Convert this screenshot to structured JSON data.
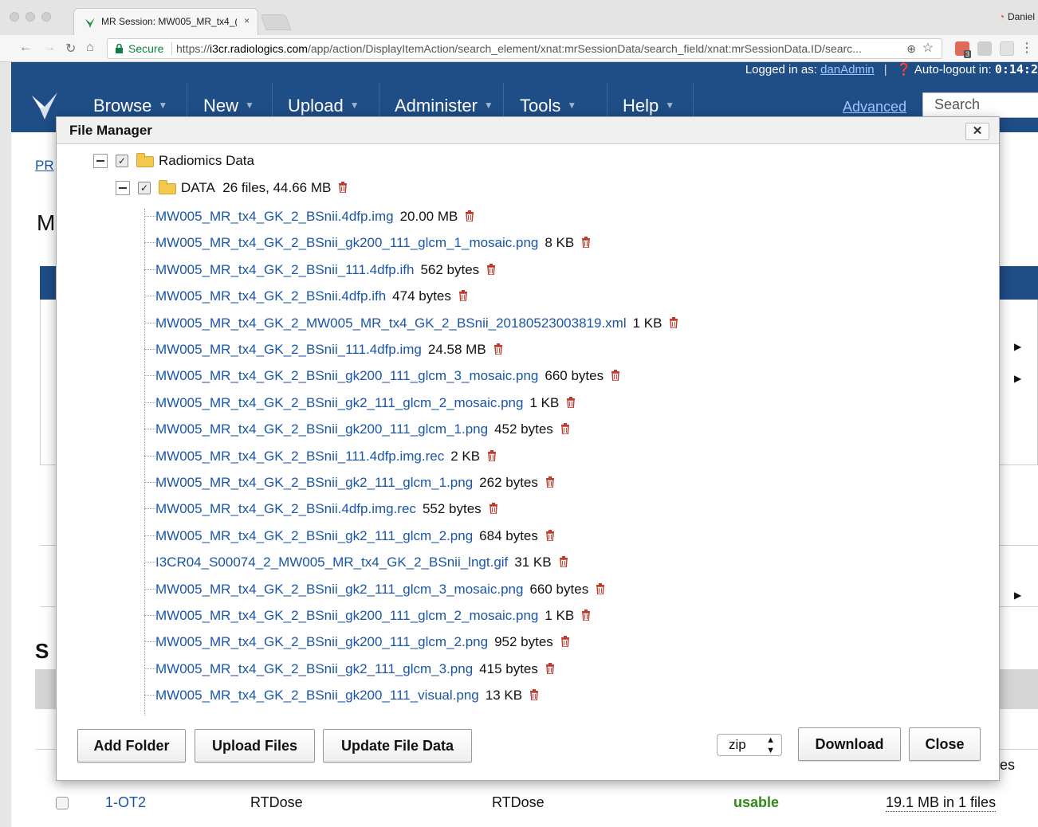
{
  "browser": {
    "tab_title": "MR Session: MW005_MR_tx4_(",
    "tab_close": "×",
    "profile_name": "Daniel",
    "secure_label": "Secure",
    "url_scheme": "https://",
    "url_host": "i3cr.radiologics.com",
    "url_path": "/app/action/DisplayItemAction/search_element/xnat:mrSessionData/search_field/xnat:mrSessionData.ID/searc...",
    "extension_badge": "3"
  },
  "header": {
    "logged_in_label": "Logged in as:",
    "username": "danAdmin",
    "autologout_label": "Auto-logout in:",
    "autologout_time": "0:14:2",
    "nav": [
      "Browse",
      "New",
      "Upload",
      "Administer",
      "Tools",
      "Help"
    ],
    "advanced_label": "Advanced",
    "search_placeholder": "Search"
  },
  "page": {
    "breadcrumb_fragment": "PR",
    "heading_fragment": "M",
    "section_fragment": "S",
    "peek_text": "es",
    "table_row": {
      "id": "1-OT2",
      "type": "RTDose",
      "description": "RTDose",
      "status": "usable",
      "files": "19.1 MB in 1 files"
    }
  },
  "modal": {
    "title": "File Manager",
    "close_glyph": "✕",
    "root_folder": "Radiomics Data",
    "data_folder": {
      "name": "DATA",
      "summary": "26 files, 44.66 MB"
    },
    "files": [
      {
        "name": "MW005_MR_tx4_GK_2_BSnii.4dfp.img",
        "size": "20.00 MB"
      },
      {
        "name": "MW005_MR_tx4_GK_2_BSnii_gk200_111_glcm_1_mosaic.png",
        "size": "8 KB"
      },
      {
        "name": "MW005_MR_tx4_GK_2_BSnii_111.4dfp.ifh",
        "size": "562 bytes"
      },
      {
        "name": "MW005_MR_tx4_GK_2_BSnii.4dfp.ifh",
        "size": "474 bytes"
      },
      {
        "name": "MW005_MR_tx4_GK_2_MW005_MR_tx4_GK_2_BSnii_20180523003819.xml",
        "size": "1 KB"
      },
      {
        "name": "MW005_MR_tx4_GK_2_BSnii_111.4dfp.img",
        "size": "24.58 MB"
      },
      {
        "name": "MW005_MR_tx4_GK_2_BSnii_gk200_111_glcm_3_mosaic.png",
        "size": "660 bytes"
      },
      {
        "name": "MW005_MR_tx4_GK_2_BSnii_gk2_111_glcm_2_mosaic.png",
        "size": "1 KB"
      },
      {
        "name": "MW005_MR_tx4_GK_2_BSnii_gk200_111_glcm_1.png",
        "size": "452 bytes"
      },
      {
        "name": "MW005_MR_tx4_GK_2_BSnii_111.4dfp.img.rec",
        "size": "2 KB"
      },
      {
        "name": "MW005_MR_tx4_GK_2_BSnii_gk2_111_glcm_1.png",
        "size": "262 bytes"
      },
      {
        "name": "MW005_MR_tx4_GK_2_BSnii.4dfp.img.rec",
        "size": "552 bytes"
      },
      {
        "name": "MW005_MR_tx4_GK_2_BSnii_gk2_111_glcm_2.png",
        "size": "684 bytes"
      },
      {
        "name": "I3CR04_S00074_2_MW005_MR_tx4_GK_2_BSnii_lngt.gif",
        "size": "31 KB"
      },
      {
        "name": "MW005_MR_tx4_GK_2_BSnii_gk2_111_glcm_3_mosaic.png",
        "size": "660 bytes"
      },
      {
        "name": "MW005_MR_tx4_GK_2_BSnii_gk200_111_glcm_2_mosaic.png",
        "size": "1 KB"
      },
      {
        "name": "MW005_MR_tx4_GK_2_BSnii_gk200_111_glcm_2.png",
        "size": "952 bytes"
      },
      {
        "name": "MW005_MR_tx4_GK_2_BSnii_gk2_111_glcm_3.png",
        "size": "415 bytes"
      },
      {
        "name": "MW005_MR_tx4_GK_2_BSnii_gk200_111_visual.png",
        "size": "13 KB"
      }
    ],
    "buttons": {
      "add_folder": "Add Folder",
      "upload_files": "Upload Files",
      "update_file_data": "Update File Data",
      "download": "Download",
      "close": "Close"
    },
    "format_select": {
      "selected": "zip"
    }
  },
  "icons": {
    "file_row_trash": "trash-icon",
    "folder": "folder-icon",
    "checkbox": "checkbox-checked-icon"
  },
  "colors": {
    "header_blue": "#1f4d86",
    "link_blue": "#1a55a8",
    "trash_red": "#c0392b",
    "status_green": "#2e8b1a"
  }
}
